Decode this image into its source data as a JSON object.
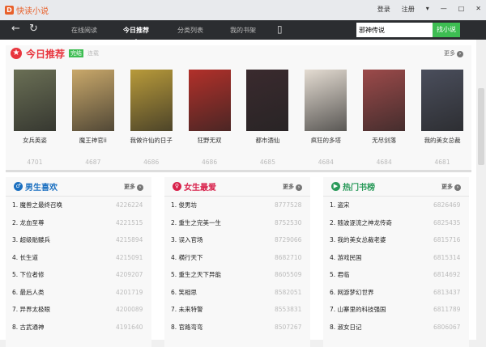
{
  "app": {
    "title": "快读小说",
    "logo_letter": "D"
  },
  "window": {
    "login": "登录",
    "register": "注册",
    "menu": "▾",
    "minimize": "—",
    "maximize": "□",
    "close": "✕"
  },
  "nav": {
    "back": "←",
    "refresh": "↻",
    "items": [
      "在线阅读",
      "今日推荐",
      "分类列表",
      "我的书架"
    ],
    "active": 1,
    "phone": "▯"
  },
  "search": {
    "value": "邪神传说",
    "button": "找小说"
  },
  "today": {
    "title": "今日推荐",
    "tag_active": "完结",
    "tag_inactive": "连载",
    "more": "更多",
    "books": [
      {
        "name": "女兵英姿",
        "count": "4701",
        "color": "#6a6f55"
      },
      {
        "name": "魔王神官ii",
        "count": "4687",
        "color": "#c9a86a"
      },
      {
        "name": "我做许仙的日子",
        "count": "4686",
        "color": "#b89a3a"
      },
      {
        "name": "狂野无双",
        "count": "4686",
        "color": "#b2302a"
      },
      {
        "name": "都市酒仙",
        "count": "4685",
        "color": "#3a2a2e"
      },
      {
        "name": "疯狂的多塔",
        "count": "4684",
        "color": "#e4dcd2"
      },
      {
        "name": "无尽剑落",
        "count": "4684",
        "color": "#9c4a4a"
      },
      {
        "name": "我的美女总裁",
        "count": "4681",
        "color": "#4a4e5c"
      }
    ]
  },
  "panels": [
    {
      "title": "男生喜欢",
      "color": "#1a6fc0",
      "icon": "♂",
      "more": "更多",
      "items": [
        {
          "name": "1. 魔兽之最终召唤",
          "count": "4226224"
        },
        {
          "name": "2. 龙血至尊",
          "count": "4221515"
        },
        {
          "name": "3. 超级骷髅兵",
          "count": "4215894"
        },
        {
          "name": "4. 长生道",
          "count": "4215091"
        },
        {
          "name": "5. 下位者修",
          "count": "4209207"
        },
        {
          "name": "6. 最后人类",
          "count": "4201719"
        },
        {
          "name": "7. 异界太极眼",
          "count": "4200089"
        },
        {
          "name": "8. 古武通神",
          "count": "4191640"
        }
      ]
    },
    {
      "title": "女生最爱",
      "color": "#d8204a",
      "icon": "♀",
      "more": "更多",
      "items": [
        {
          "name": "1. 俊男坊",
          "count": "8777528"
        },
        {
          "name": "2. 重生之完美一生",
          "count": "8752530"
        },
        {
          "name": "3. 误入官场",
          "count": "8729066"
        },
        {
          "name": "4. 横行天下",
          "count": "8682710"
        },
        {
          "name": "5. 重生之天下异能",
          "count": "8605509"
        },
        {
          "name": "6. 笑相思",
          "count": "8582051"
        },
        {
          "name": "7. 未来特警",
          "count": "8553831"
        },
        {
          "name": "8. 官路弯弯",
          "count": "8507267"
        }
      ]
    },
    {
      "title": "热门书榜",
      "color": "#2a9a5a",
      "icon": "▶",
      "more": "更多",
      "items": [
        {
          "name": "1. 盗宋",
          "count": "6826469"
        },
        {
          "name": "2. 随波逐流之神龙传奇",
          "count": "6825435"
        },
        {
          "name": "3. 我的美女总裁老婆",
          "count": "6815716"
        },
        {
          "name": "4. 游戏民国",
          "count": "6815314"
        },
        {
          "name": "5. 君临",
          "count": "6814692"
        },
        {
          "name": "6. 网游梦幻世界",
          "count": "6813437"
        },
        {
          "name": "7. 山寨里的科技强国",
          "count": "6811789"
        },
        {
          "name": "8. 淑女日记",
          "count": "6806067"
        }
      ]
    }
  ]
}
